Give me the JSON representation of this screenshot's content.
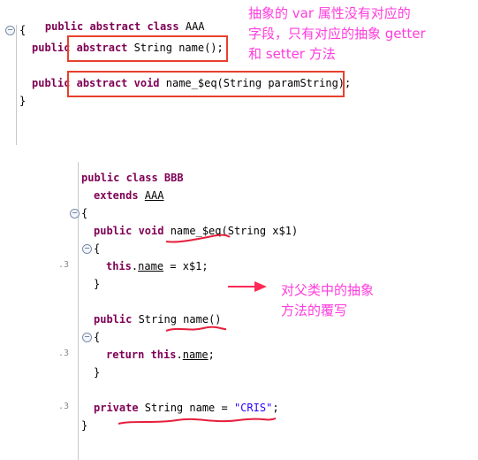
{
  "panel_top": {
    "lines": [
      [
        [
          "public abstract class AAA",
          "kw"
        ]
      ],
      [
        [
          "{",
          ""
        ]
      ],
      [
        [
          "public ",
          "kw"
        ],
        [
          "abstract",
          "kw"
        ],
        [
          " String name();",
          ""
        ]
      ],
      [
        [
          "public ",
          "kw"
        ],
        [
          "abstract void",
          "kw"
        ],
        [
          " name_$eq(String paramString);",
          ""
        ]
      ],
      [
        [
          "}",
          ""
        ]
      ]
    ],
    "annotation": [
      "抽象的 var 属性没有对应的",
      "字段，只有对应的抽象 getter",
      "和 setter 方法"
    ]
  },
  "panel_bottom": {
    "lines": {
      "l1": "public class BBB",
      "l2a": "extends ",
      "l2b": "AAA",
      "l3": "{",
      "l4a": "public void ",
      "l4b": "name_$eq",
      "l4c": "(String x$1)",
      "l5": "{",
      "l6a": "this",
      "l6b": ".",
      "l6c": "name",
      "l6d": " = x$1;",
      "l7": "}",
      "l8a": "public ",
      "l8b": "String ",
      "l8c": "name",
      "l8d": "()",
      "l9": "{",
      "l10a": "return ",
      "l10b": "this",
      "l10c": ".",
      "l10d": "name",
      "l10e": ";",
      "l11": "}",
      "l12a": "private ",
      "l12b": "String name = ",
      "l12c": "\"CRIS\"",
      "l12d": ";",
      "l13": "}"
    },
    "line_numbers": [
      ".3",
      ".3",
      ".3"
    ],
    "annotation": [
      "对父类中的抽象",
      "方法的覆写"
    ]
  },
  "colors": {
    "keyword": "#7f0055",
    "string": "#2a00ff",
    "annotation": "#ff3cdc",
    "box": "#e8412d",
    "arrow": "#ff2a55"
  },
  "icons": [
    "fold-collapse-icon",
    "arrow-right-icon"
  ]
}
